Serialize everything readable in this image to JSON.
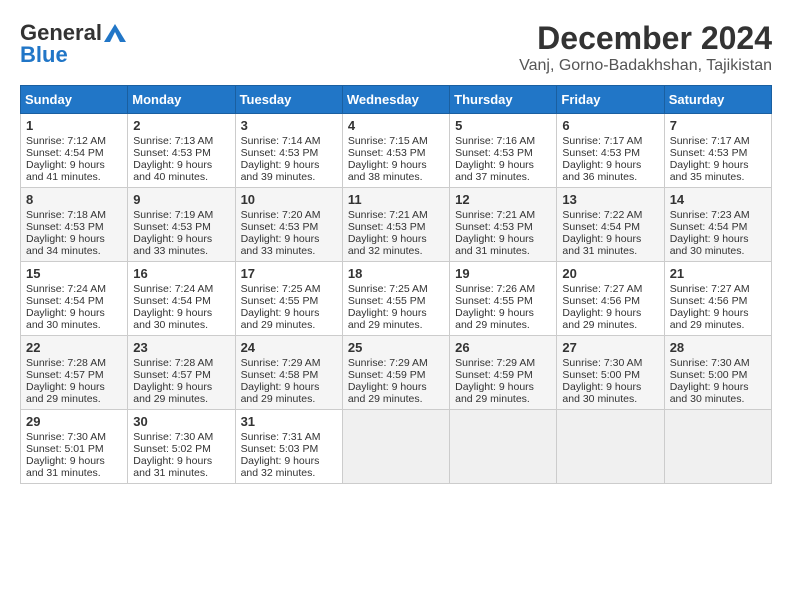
{
  "logo": {
    "line1": "General",
    "line2": "Blue"
  },
  "title": "December 2024",
  "subtitle": "Vanj, Gorno-Badakhshan, Tajikistan",
  "days_of_week": [
    "Sunday",
    "Monday",
    "Tuesday",
    "Wednesday",
    "Thursday",
    "Friday",
    "Saturday"
  ],
  "weeks": [
    [
      {
        "day": "1",
        "sunrise": "7:12 AM",
        "sunset": "4:54 PM",
        "daylight": "9 hours and 41 minutes."
      },
      {
        "day": "2",
        "sunrise": "7:13 AM",
        "sunset": "4:53 PM",
        "daylight": "9 hours and 40 minutes."
      },
      {
        "day": "3",
        "sunrise": "7:14 AM",
        "sunset": "4:53 PM",
        "daylight": "9 hours and 39 minutes."
      },
      {
        "day": "4",
        "sunrise": "7:15 AM",
        "sunset": "4:53 PM",
        "daylight": "9 hours and 38 minutes."
      },
      {
        "day": "5",
        "sunrise": "7:16 AM",
        "sunset": "4:53 PM",
        "daylight": "9 hours and 37 minutes."
      },
      {
        "day": "6",
        "sunrise": "7:17 AM",
        "sunset": "4:53 PM",
        "daylight": "9 hours and 36 minutes."
      },
      {
        "day": "7",
        "sunrise": "7:17 AM",
        "sunset": "4:53 PM",
        "daylight": "9 hours and 35 minutes."
      }
    ],
    [
      {
        "day": "8",
        "sunrise": "7:18 AM",
        "sunset": "4:53 PM",
        "daylight": "9 hours and 34 minutes."
      },
      {
        "day": "9",
        "sunrise": "7:19 AM",
        "sunset": "4:53 PM",
        "daylight": "9 hours and 33 minutes."
      },
      {
        "day": "10",
        "sunrise": "7:20 AM",
        "sunset": "4:53 PM",
        "daylight": "9 hours and 33 minutes."
      },
      {
        "day": "11",
        "sunrise": "7:21 AM",
        "sunset": "4:53 PM",
        "daylight": "9 hours and 32 minutes."
      },
      {
        "day": "12",
        "sunrise": "7:21 AM",
        "sunset": "4:53 PM",
        "daylight": "9 hours and 31 minutes."
      },
      {
        "day": "13",
        "sunrise": "7:22 AM",
        "sunset": "4:54 PM",
        "daylight": "9 hours and 31 minutes."
      },
      {
        "day": "14",
        "sunrise": "7:23 AM",
        "sunset": "4:54 PM",
        "daylight": "9 hours and 30 minutes."
      }
    ],
    [
      {
        "day": "15",
        "sunrise": "7:24 AM",
        "sunset": "4:54 PM",
        "daylight": "9 hours and 30 minutes."
      },
      {
        "day": "16",
        "sunrise": "7:24 AM",
        "sunset": "4:54 PM",
        "daylight": "9 hours and 30 minutes."
      },
      {
        "day": "17",
        "sunrise": "7:25 AM",
        "sunset": "4:55 PM",
        "daylight": "9 hours and 29 minutes."
      },
      {
        "day": "18",
        "sunrise": "7:25 AM",
        "sunset": "4:55 PM",
        "daylight": "9 hours and 29 minutes."
      },
      {
        "day": "19",
        "sunrise": "7:26 AM",
        "sunset": "4:55 PM",
        "daylight": "9 hours and 29 minutes."
      },
      {
        "day": "20",
        "sunrise": "7:27 AM",
        "sunset": "4:56 PM",
        "daylight": "9 hours and 29 minutes."
      },
      {
        "day": "21",
        "sunrise": "7:27 AM",
        "sunset": "4:56 PM",
        "daylight": "9 hours and 29 minutes."
      }
    ],
    [
      {
        "day": "22",
        "sunrise": "7:28 AM",
        "sunset": "4:57 PM",
        "daylight": "9 hours and 29 minutes."
      },
      {
        "day": "23",
        "sunrise": "7:28 AM",
        "sunset": "4:57 PM",
        "daylight": "9 hours and 29 minutes."
      },
      {
        "day": "24",
        "sunrise": "7:29 AM",
        "sunset": "4:58 PM",
        "daylight": "9 hours and 29 minutes."
      },
      {
        "day": "25",
        "sunrise": "7:29 AM",
        "sunset": "4:59 PM",
        "daylight": "9 hours and 29 minutes."
      },
      {
        "day": "26",
        "sunrise": "7:29 AM",
        "sunset": "4:59 PM",
        "daylight": "9 hours and 29 minutes."
      },
      {
        "day": "27",
        "sunrise": "7:30 AM",
        "sunset": "5:00 PM",
        "daylight": "9 hours and 30 minutes."
      },
      {
        "day": "28",
        "sunrise": "7:30 AM",
        "sunset": "5:00 PM",
        "daylight": "9 hours and 30 minutes."
      }
    ],
    [
      {
        "day": "29",
        "sunrise": "7:30 AM",
        "sunset": "5:01 PM",
        "daylight": "9 hours and 31 minutes."
      },
      {
        "day": "30",
        "sunrise": "7:30 AM",
        "sunset": "5:02 PM",
        "daylight": "9 hours and 31 minutes."
      },
      {
        "day": "31",
        "sunrise": "7:31 AM",
        "sunset": "5:03 PM",
        "daylight": "9 hours and 32 minutes."
      },
      null,
      null,
      null,
      null
    ]
  ]
}
